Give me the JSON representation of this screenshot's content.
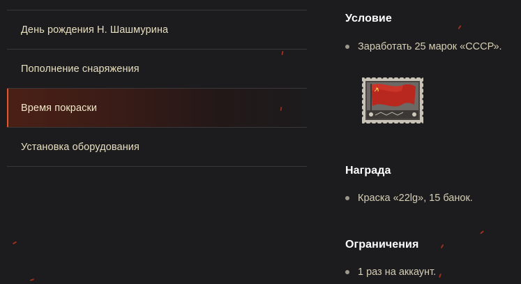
{
  "task_list": {
    "items": [
      {
        "label": "День рождения Н. Шашмурина",
        "active": false
      },
      {
        "label": "Пополнение снаряжения",
        "active": false
      },
      {
        "label": "Время покраски",
        "active": true
      },
      {
        "label": "Установка оборудования",
        "active": false
      }
    ]
  },
  "details": {
    "condition": {
      "title": "Условие",
      "items": [
        "Заработать 25 марок «СССР»."
      ]
    },
    "stamp": {
      "icon": "ussr-flag-stamp-icon"
    },
    "reward": {
      "title": "Награда",
      "items": [
        "Краска «22lg», 15 банок."
      ]
    },
    "restrictions": {
      "title": "Ограничения",
      "items": [
        "1 раз на аккаунт."
      ]
    }
  },
  "colors": {
    "background": "#1c1b1d",
    "accent": "#e5562b",
    "divider": "#3a383b",
    "list_text": "#e8dfc0",
    "detail_text": "#d6cfb6"
  }
}
